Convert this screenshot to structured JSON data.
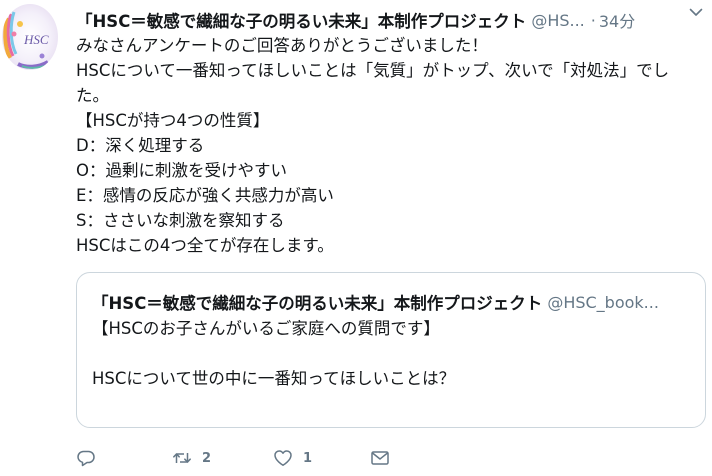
{
  "tweet": {
    "author_name": "「HSC＝敏感で繊細な子の明るい未来」本制作プロジェクト",
    "handle": "@HS...",
    "separator": "·",
    "time": "34分",
    "avatar_label": "HSC",
    "body_lines": [
      "みなさんアンケートのご回答ありがとうございました！",
      "HSCについて一番知ってほしいことは「気質」がトップ、次いで「対処法」でし",
      "た。",
      "【HSCが持つ4つの性質】",
      "D：深く処理する",
      "O：過剰に刺激を受けやすい",
      "E：感情の反応が強く共感力が高い",
      "S：ささいな刺激を察知する",
      "HSCはこの4つ全てが存在します。"
    ]
  },
  "quote": {
    "author_name": "「HSC＝敏感で繊細な子の明るい未来」本制作プロジェクト",
    "handle": "@HSC_book...",
    "lines": [
      "【HSCのお子さんがいるご家庭への質問です】",
      "",
      "HSCについて世の中に一番知ってほしいことは？"
    ]
  },
  "actions": {
    "reply_count": "",
    "retweet_count": "2",
    "like_count": "1"
  },
  "colors": {
    "text": "#14171a",
    "secondary": "#657786",
    "border": "#ccd6dd"
  }
}
